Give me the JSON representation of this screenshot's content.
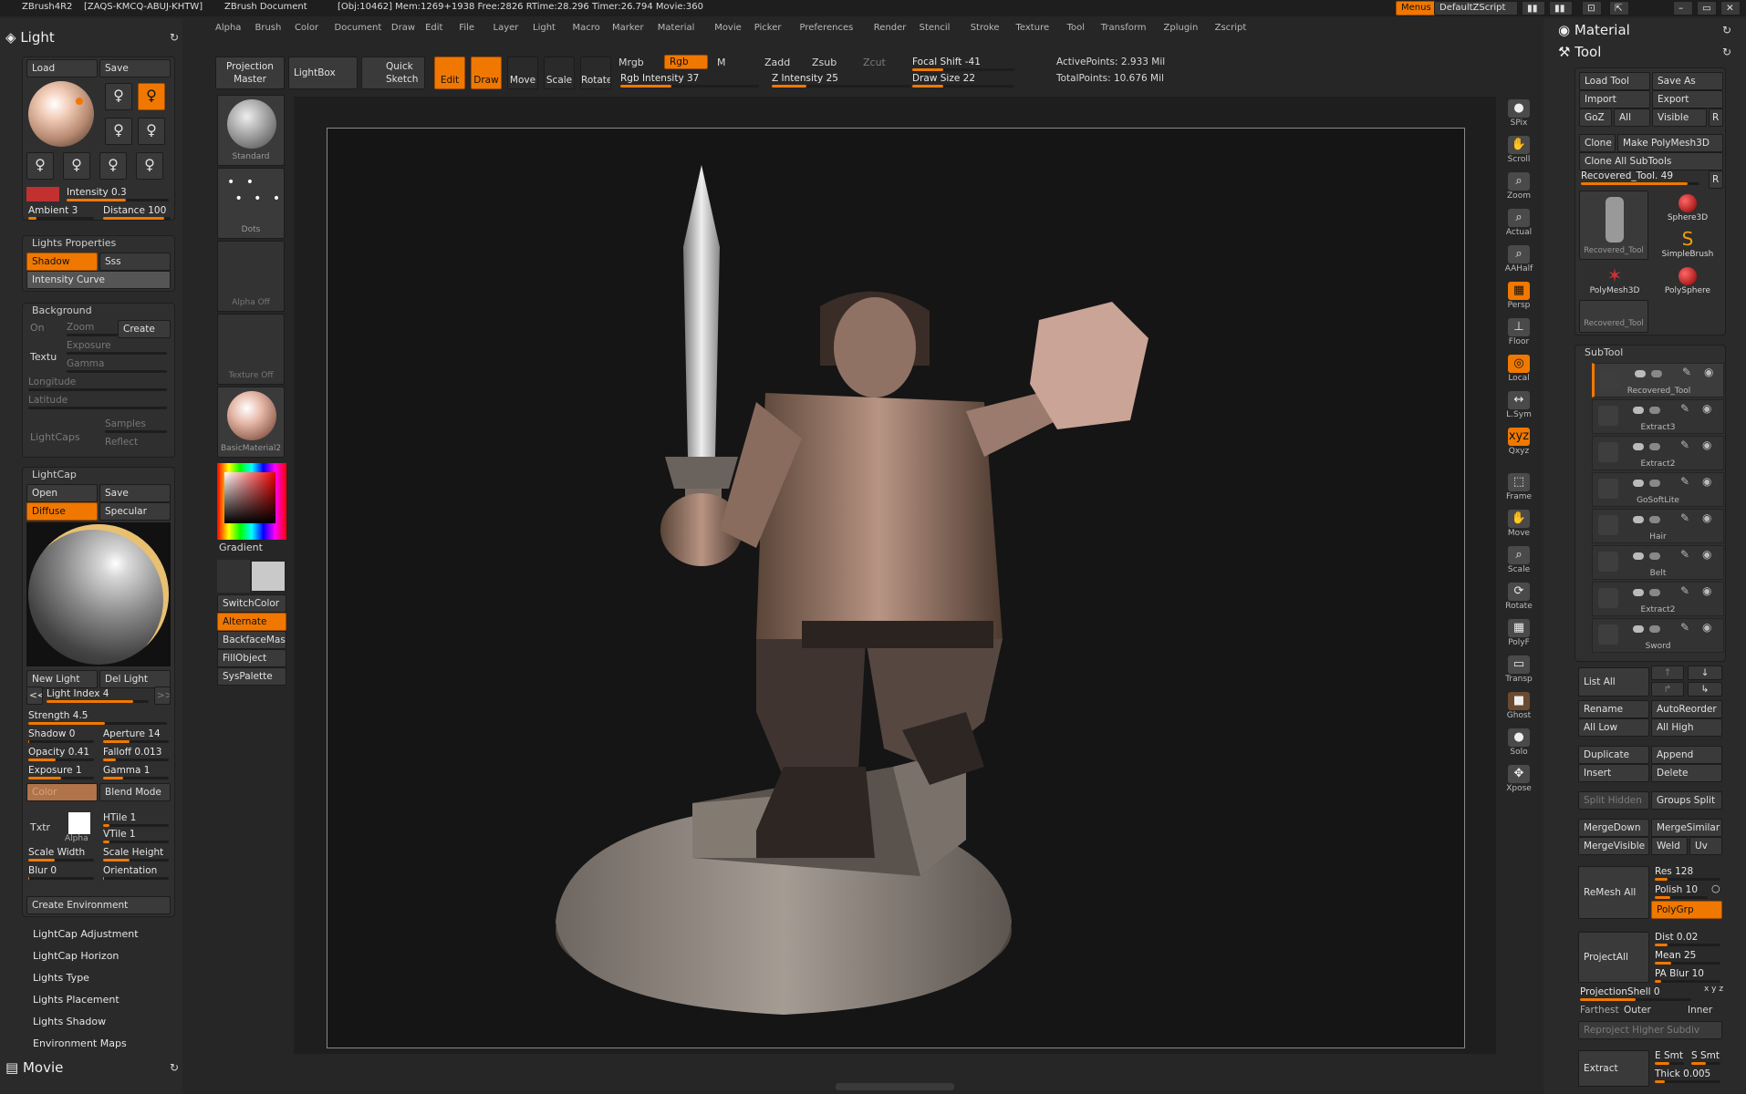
{
  "titlebar": {
    "app": "ZBrush4R2",
    "serial": "[ZAQS-KMCQ-ABUJ-KHTW]",
    "doc": "ZBrush Document",
    "stats": "[Obj:10462] Mem:1269+1938 Free:2826 RTime:28.296 Timer:26.794 Movie:360",
    "menus_btn": "Menus",
    "script": "DefaultZScript"
  },
  "menubar": [
    "Alpha",
    "Brush",
    "Color",
    "Document",
    "Draw",
    "Edit",
    "File",
    "Layer",
    "Light",
    "Macro",
    "Marker",
    "Material",
    "Movie",
    "Picker",
    "Preferences",
    "Render",
    "Stencil",
    "Stroke",
    "Texture",
    "Tool",
    "Transform",
    "Zplugin",
    "Zscript"
  ],
  "left": {
    "light_title": "Light",
    "load": "Load",
    "save": "Save",
    "intensity": "Intensity 0.3",
    "ambient": "Ambient 3",
    "distance": "Distance 100",
    "lights_properties": "Lights Properties",
    "shadow": "Shadow",
    "sss": "Sss",
    "intensity_curve": "Intensity Curve",
    "background": "Background",
    "bg_on": "On",
    "bg_zoom": "Zoom",
    "bg_create": "Create",
    "bg_texture": "Textu",
    "bg_exposure": "Exposure",
    "bg_gamma": "Gamma",
    "bg_longitude": "Longitude",
    "bg_latitude": "Latitude",
    "bg_lightcaps": "LightCaps",
    "bg_samples": "Samples",
    "bg_reflect": "Reflect",
    "lightcap": "LightCap",
    "open": "Open",
    "lc_save": "Save",
    "diffuse": "Diffuse",
    "specular": "Specular",
    "new_light": "New Light",
    "del_light": "Del Light",
    "light_index": "Light Index 4",
    "strength": "Strength 4.5",
    "shadow_v": "Shadow 0",
    "aperture": "Aperture 14",
    "opacity": "Opacity 0.41",
    "falloff": "Falloff 0.013",
    "exposure": "Exposure 1",
    "gamma": "Gamma 1",
    "color": "Color",
    "blend_mode": "Blend Mode",
    "txtr": "Txtr",
    "alpha": "Alpha",
    "htile": "HTile 1",
    "vtile": "VTile 1",
    "scale_width": "Scale Width",
    "scale_height": "Scale Height",
    "blur": "Blur 0",
    "orientation": "Orientation",
    "create_env": "Create Environment",
    "sections": [
      "LightCap Adjustment",
      "LightCap Horizon",
      "Lights Type",
      "Lights Placement",
      "Lights Shadow",
      "Environment Maps"
    ],
    "movie": "Movie"
  },
  "shelf": {
    "projection_master": "Projection Master",
    "lightbox": "LightBox",
    "quick_sketch": "Quick Sketch",
    "edit": "Edit",
    "draw": "Draw",
    "move": "Move",
    "scale": "Scale",
    "rotate": "Rotate",
    "mrgb": "Mrgb",
    "rgb": "Rgb",
    "m": "M",
    "rgb_intensity": "Rgb Intensity 37",
    "zadd": "Zadd",
    "zsub": "Zsub",
    "zcut": "Zcut",
    "z_intensity": "Z Intensity 25",
    "focal_shift": "Focal Shift -41",
    "draw_size": "Draw Size 22",
    "active_points": "ActivePoints: 2.933 Mil",
    "total_points": "TotalPoints: 10.676 Mil"
  },
  "leftshelf": {
    "standard": "Standard",
    "dots": "Dots",
    "alpha_off": "Alpha Off",
    "texture_off": "Texture Off",
    "material": "BasicMaterial2",
    "gradient": "Gradient",
    "switchcolor": "SwitchColor",
    "alternate": "Alternate",
    "backface": "BackfaceMas",
    "fillobject": "FillObject",
    "syspalette": "SysPalette"
  },
  "rightshelf": [
    "SPix",
    "Scroll",
    "Zoom",
    "Actual",
    "AAHalf",
    "Persp",
    "Floor",
    "Local",
    "L.Sym",
    "Qxyz",
    "Frame",
    "Move",
    "Scale",
    "Rotate",
    "PolyF",
    "Transp",
    "Ghost",
    "Solo",
    "Xpose"
  ],
  "right": {
    "material": "Material",
    "tool": "Tool",
    "load_tool": "Load Tool",
    "save_as": "Save As",
    "import": "Import",
    "export": "Export",
    "goz": "GoZ",
    "all": "All",
    "visible": "Visible",
    "r": "R",
    "clone": "Clone",
    "make_polymesh": "Make PolyMesh3D",
    "clone_all": "Clone All SubTools",
    "recovered": "Recovered_Tool. 49",
    "tools": [
      "Recovered_Tool",
      "Sphere3D",
      "SimpleBrush",
      "PolyMesh3D",
      "PolySphere",
      "Recovered_Tool"
    ],
    "subtool_title": "SubTool",
    "subtools": [
      "Recovered_Tool",
      "Extract3",
      "Extract2",
      "GoSoftLite",
      "Hair",
      "Belt",
      "Extract2",
      "Sword"
    ],
    "list_all": "List All",
    "rename": "Rename",
    "autoreorder": "AutoReorder",
    "all_low": "All Low",
    "all_high": "All High",
    "duplicate": "Duplicate",
    "append": "Append",
    "insert": "Insert",
    "delete": "Delete",
    "split_hidden": "Split Hidden",
    "groups_split": "Groups Split",
    "mergedown": "MergeDown",
    "mergesimilar": "MergeSimilar",
    "mergevisible": "MergeVisible",
    "weld": "Weld",
    "uv": "Uv",
    "remesh_all": "ReMesh All",
    "res": "Res 128",
    "polish": "Polish 10",
    "polygrp": "PolyGrp",
    "project_all": "ProjectAll",
    "dist": "Dist 0.02",
    "mean": "Mean 25",
    "pa_blur": "PA Blur 10",
    "projection_shell": "ProjectionShell 0",
    "farthest": "Farthest",
    "outer": "Outer",
    "inner": "Inner",
    "reproject": "Reproject Higher Subdiv",
    "extract": "Extract",
    "e_smt": "E Smt",
    "s_smt": "S Smt",
    "thick": "Thick 0.005"
  }
}
